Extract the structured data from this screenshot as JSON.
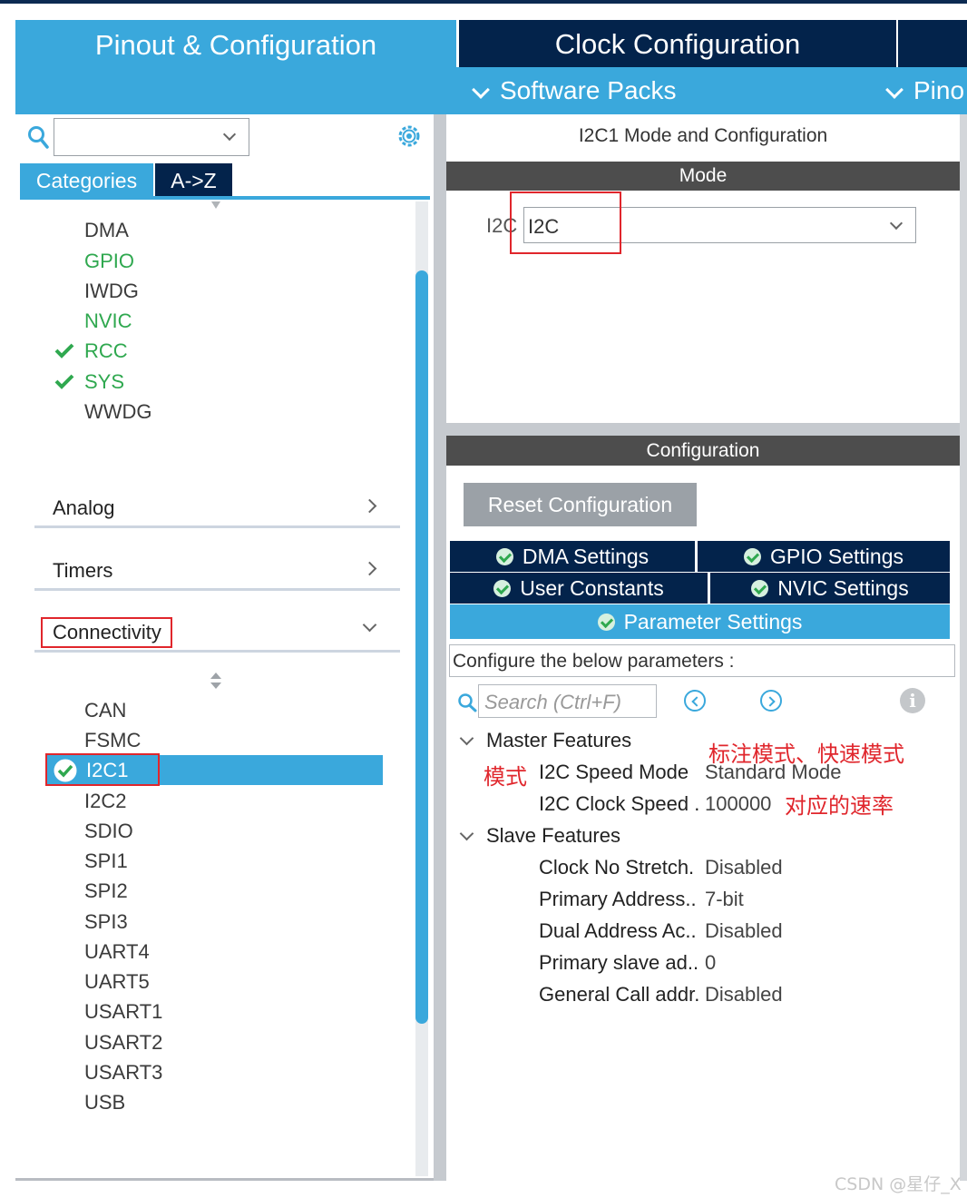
{
  "header": {
    "tab_pinout": "Pinout & Configuration",
    "tab_clock": "Clock Configuration",
    "subbar": [
      {
        "label": "Software Packs"
      },
      {
        "label": "Pino"
      }
    ]
  },
  "left": {
    "search_value": "",
    "tabs": {
      "categories": "Categories",
      "az": "A->Z"
    },
    "system_items": [
      {
        "label": "DMA",
        "color": "#3b3b3b",
        "checked": false
      },
      {
        "label": "GPIO",
        "color": "#2fa84f",
        "checked": false
      },
      {
        "label": "IWDG",
        "color": "#3b3b3b",
        "checked": false
      },
      {
        "label": "NVIC",
        "color": "#2fa84f",
        "checked": false
      },
      {
        "label": "RCC",
        "color": "#2fa84f",
        "checked": true
      },
      {
        "label": "SYS",
        "color": "#2fa84f",
        "checked": true
      },
      {
        "label": "WWDG",
        "color": "#3b3b3b",
        "checked": false
      }
    ],
    "groups": {
      "analog": "Analog",
      "timers": "Timers",
      "connectivity": "Connectivity"
    },
    "connectivity_items": [
      "CAN",
      "FSMC",
      "I2C1",
      "I2C2",
      "SDIO",
      "SPI1",
      "SPI2",
      "SPI3",
      "UART4",
      "UART5",
      "USART1",
      "USART2",
      "USART3",
      "USB"
    ],
    "selected_item": "I2C1"
  },
  "right": {
    "title": "I2C1 Mode and Configuration",
    "mode_header": "Mode",
    "mode_label": "I2C",
    "mode_value": "I2C",
    "config_header": "Configuration",
    "reset_button": "Reset Configuration",
    "tabs": {
      "dma": "DMA Settings",
      "gpio": "GPIO Settings",
      "user_constants": "User Constants",
      "nvic": "NVIC Settings",
      "parameter": "Parameter Settings"
    },
    "param_hint": "Configure the below parameters :",
    "search_placeholder": "Search (Ctrl+F)",
    "info_glyph": "i",
    "master_group": "Master Features",
    "master_params": [
      {
        "name": "I2C Speed Mode",
        "value": "Standard Mode"
      },
      {
        "name": "I2C Clock Speed .",
        "value": "100000"
      }
    ],
    "slave_group": "Slave Features",
    "slave_params": [
      {
        "name": "Clock No Stretch.",
        "value": "Disabled"
      },
      {
        "name": "Primary Address..",
        "value": "7-bit"
      },
      {
        "name": "Dual Address Ac..",
        "value": "Disabled"
      },
      {
        "name": "Primary slave ad..",
        "value": "0"
      },
      {
        "name": "General Call addr.",
        "value": "Disabled"
      }
    ]
  },
  "annotations": {
    "line1": "标注模式、快速模式",
    "line2": "模式",
    "line3": "对应的速率",
    "color": "#e0262c"
  },
  "watermark": "CSDN @星仔_X",
  "colors": {
    "accent": "#3aa8dc",
    "dark_navy": "#03234b",
    "header_gray": "#4d4d4d",
    "ok_green": "#2fa84f"
  }
}
